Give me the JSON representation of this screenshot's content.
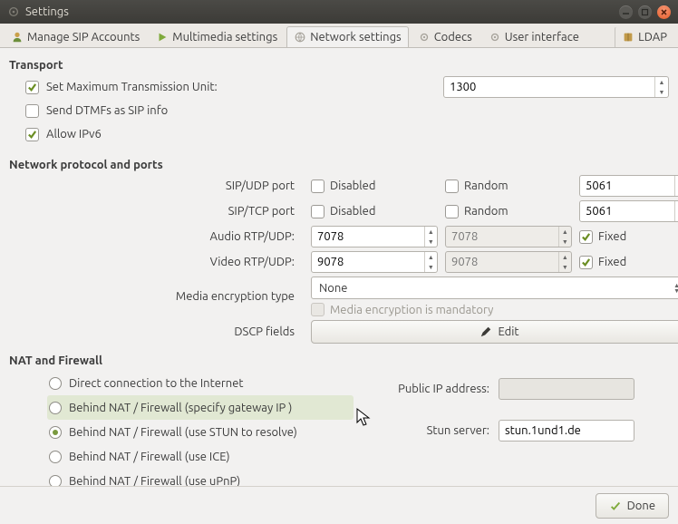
{
  "window": {
    "title": "Settings"
  },
  "tabs": {
    "accounts": "Manage SIP Accounts",
    "multimedia": "Multimedia settings",
    "network": "Network settings",
    "codecs": "Codecs",
    "ui": "User interface",
    "ldap": "LDAP"
  },
  "sections": {
    "transport": "Transport",
    "protocol": "Network protocol and ports",
    "nat": "NAT and Firewall"
  },
  "transport": {
    "mtu_label": "Set Maximum Transmission Unit:",
    "mtu_value": "1300",
    "dtmf_label": "Send DTMFs as SIP info",
    "ipv6_label": "Allow IPv6"
  },
  "ports": {
    "sip_udp_label": "SIP/UDP port",
    "sip_tcp_label": "SIP/TCP port",
    "audio_label": "Audio RTP/UDP:",
    "video_label": "Video RTP/UDP:",
    "media_enc_label": "Media encryption type",
    "dscp_label": "DSCP fields",
    "disabled": "Disabled",
    "random": "Random",
    "fixed": "Fixed",
    "mandatory": "Media encryption is mandatory",
    "edit": "Edit",
    "sip_udp_port": "5061",
    "sip_tcp_port": "5061",
    "audio_port": "7078",
    "audio_port_ph": "7078",
    "video_port": "9078",
    "video_port_ph": "9078",
    "enc_value": "None"
  },
  "nat": {
    "direct": "Direct connection to the Internet",
    "gateway": "Behind NAT / Firewall (specify gateway IP )",
    "stun": "Behind NAT / Firewall (use STUN to resolve)",
    "ice": "Behind NAT / Firewall (use ICE)",
    "upnp": "Behind NAT / Firewall (use uPnP)",
    "public_ip_label": "Public IP address:",
    "stun_label": "Stun server:",
    "stun_value": "stun.1und1.de"
  },
  "footer": {
    "done": "Done"
  }
}
